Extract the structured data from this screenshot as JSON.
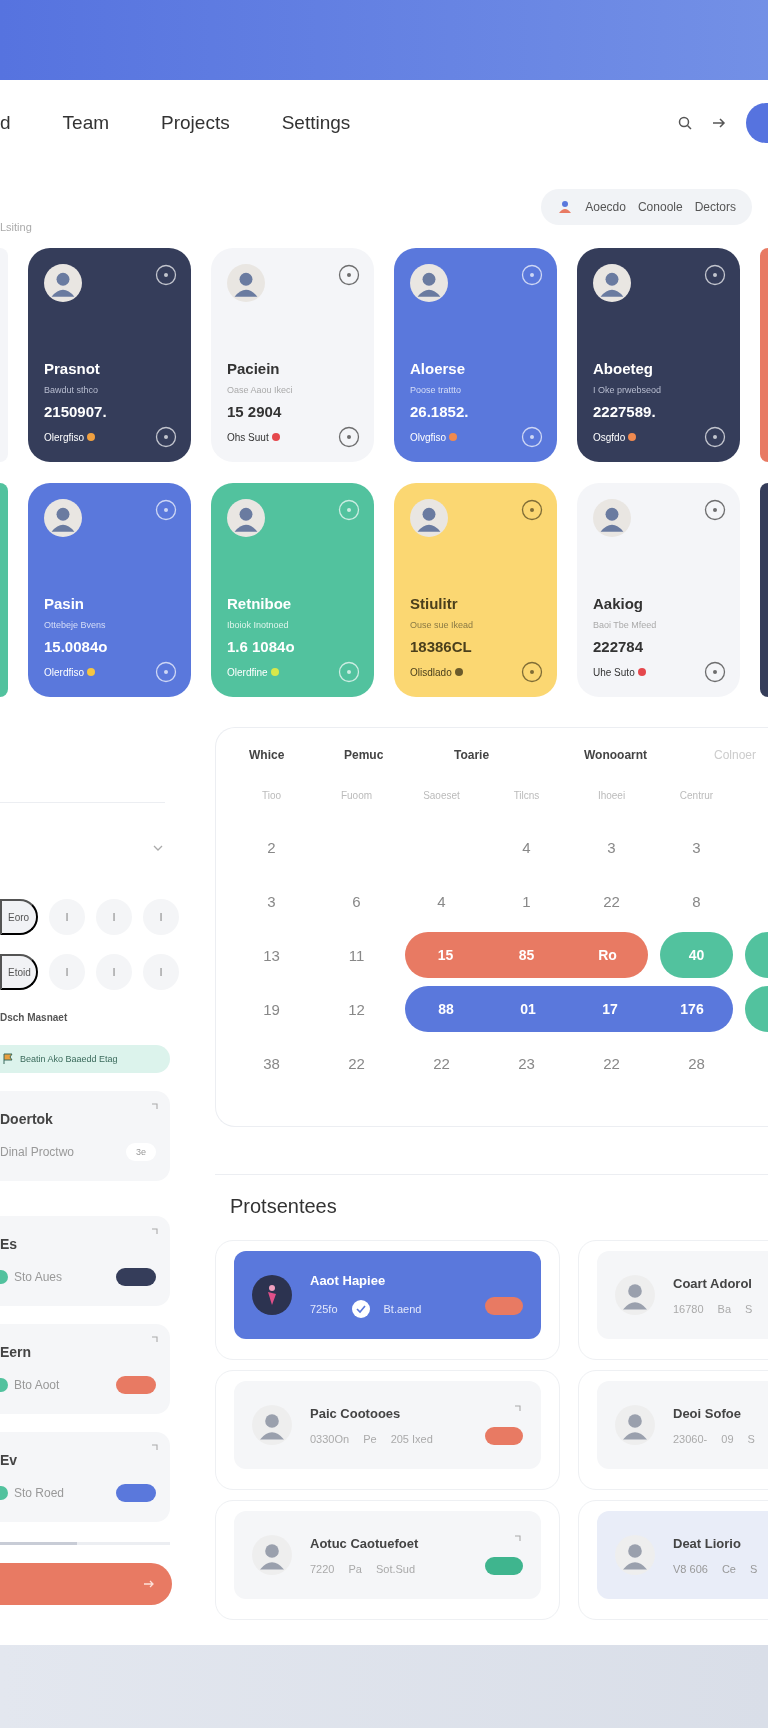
{
  "nav": {
    "tabs": [
      "d",
      "Team",
      "Projects",
      "Settings"
    ]
  },
  "subtitle": "Lsiting",
  "filter_chip": {
    "labels": [
      "Aoecdo",
      "Conoole",
      "Dectors"
    ]
  },
  "card_rows": [
    {
      "items": [
        {
          "kind": "light"
        },
        {
          "kind": "dark",
          "name": "Prasnot",
          "subtitle": "Bawdut sthco",
          "value": "2150907.",
          "footer": "Olergfiso",
          "color": "#f0a040"
        },
        {
          "kind": "light",
          "name": "Paciein",
          "subtitle": "Oase Aaou Ikeci",
          "value": "15 2904",
          "footer": "Ohs Suut",
          "color": "#e5484d"
        },
        {
          "kind": "blue",
          "name": "Aloerse",
          "subtitle": "Poose trattto",
          "value": "26.1852.",
          "footer": "Olvgfiso",
          "color": "#f08a50"
        },
        {
          "kind": "dark",
          "name": "Aboeteg",
          "subtitle": "I Oke prwebseod",
          "value": "2227589.",
          "footer": "Osgfdo",
          "color": "#f08a50"
        },
        {
          "kind": "orange"
        }
      ]
    },
    {
      "items": [
        {
          "kind": "green"
        },
        {
          "kind": "blue",
          "name": "Pasin",
          "subtitle": "Ottebeje Bvens",
          "value": "15.0084o",
          "footer": "Olerdfiso",
          "color": "#f5c542"
        },
        {
          "kind": "green",
          "name": "Retniboe",
          "subtitle": "Iboiok Inotnoed",
          "value": "1.6 1084o",
          "footer": "Olerdfine",
          "color": "#d8e84a"
        },
        {
          "kind": "yellow",
          "name": "Stiulitr",
          "subtitle": "Ouse sue Ikead",
          "value": "18386CL",
          "footer": "Olisdlado",
          "color": "#6b5a2a"
        },
        {
          "kind": "light",
          "name": "Aakiog",
          "subtitle": "Baoi Tbe Mfeed",
          "value": "222784",
          "footer": "Uhe Suto",
          "color": "#e5484d"
        },
        {
          "kind": "dark"
        }
      ]
    }
  ],
  "side_panel": {
    "pill_rows": [
      {
        "label": "Eoro",
        "marks": [
          "I",
          "I",
          "I"
        ]
      },
      {
        "label": "Etoid",
        "marks": [
          "I",
          "I",
          "I"
        ]
      }
    ],
    "section_label": "Dsch Masnaet",
    "tag": "Beatin Ako Baaedd Etag",
    "items": [
      {
        "kind": "note",
        "title": "Doertok",
        "subtitle": "Dinal Proctwo",
        "badge": "3e"
      },
      {
        "kind": "status",
        "title": "Es",
        "subtitle": "Sto Aues",
        "color": "#353d5a"
      },
      {
        "kind": "status",
        "title": "Eern",
        "subtitle": "Bto Aoot",
        "color": "#e87a63"
      },
      {
        "kind": "status",
        "title": "Ev",
        "subtitle": "Sto Roed",
        "color": "#5a78dc"
      }
    ],
    "progress": {
      "level": 0.45
    }
  },
  "calendar": {
    "headers": [
      "Whice",
      "Pemuc",
      "Toarie",
      "Wonooarnt",
      "Colnoer"
    ],
    "weekdays": [
      "Tioo",
      "Fuoom",
      "Saoeset",
      "Tilcns",
      "Ihoeei",
      "Centrur"
    ],
    "weeks": [
      {
        "cells": [
          {
            "kind": "day",
            "day": "2"
          },
          {
            "kind": "empty"
          },
          {
            "kind": "empty"
          },
          {
            "kind": "day",
            "day": "4"
          },
          {
            "kind": "day",
            "day": "3"
          },
          {
            "kind": "day",
            "day": "3"
          }
        ]
      },
      {
        "cells": [
          {
            "kind": "day",
            "day": "3"
          },
          {
            "kind": "day",
            "day": "6"
          },
          {
            "kind": "day",
            "day": "4"
          },
          {
            "kind": "day",
            "day": "1"
          },
          {
            "kind": "day",
            "day": "22"
          },
          {
            "kind": "day",
            "day": "8"
          }
        ]
      },
      {
        "cells": [
          {
            "kind": "day",
            "day": "13"
          },
          {
            "kind": "day",
            "day": "11"
          },
          {
            "kind": "event",
            "color": "#e87a63",
            "days": [
              "15",
              "85",
              "Ro"
            ]
          },
          {
            "kind": "event",
            "color": "#52c29e",
            "days": [
              "40"
            ]
          },
          {
            "kind": "event",
            "color": "#52c29e"
          }
        ]
      },
      {
        "cells": [
          {
            "kind": "day",
            "day": "19"
          },
          {
            "kind": "day",
            "day": "12"
          },
          {
            "kind": "event",
            "color": "#5a78dc",
            "days": [
              "88",
              "01",
              "17",
              "176"
            ]
          },
          {
            "kind": "event",
            "color": "#52c29e"
          }
        ]
      },
      {
        "cells": [
          {
            "kind": "day",
            "day": "38"
          },
          {
            "kind": "day",
            "day": "22"
          },
          {
            "kind": "day",
            "day": "22"
          },
          {
            "kind": "day",
            "day": "23"
          },
          {
            "kind": "day",
            "day": "22"
          },
          {
            "kind": "day",
            "day": "28"
          }
        ]
      }
    ]
  },
  "people": {
    "title": "Protsentees",
    "items": [
      {
        "kind": "primary",
        "name": "Aaot Hapiee",
        "stats": [
          "725fo",
          "Bt.aend"
        ],
        "verified": true,
        "color": "#e87a63"
      },
      {
        "kind": "plain",
        "name": "Coart Adorol",
        "stats": [
          "16780",
          "Ba",
          "S"
        ],
        "verified": false
      },
      {
        "kind": "plain",
        "name": "Paic Cootooes",
        "stats": [
          "0330On",
          "Pe",
          "205 Ixed"
        ],
        "verified": false,
        "color": "#e87a63"
      },
      {
        "kind": "plain",
        "name": "Deoi Sofoe",
        "stats": [
          "23060-",
          "09",
          "S"
        ],
        "verified": false
      },
      {
        "kind": "plain",
        "name": "Aotuc Caotuefoet",
        "stats": [
          "7220",
          "Pa",
          "Sot.Sud"
        ],
        "verified": false,
        "color": "#3fb58e"
      },
      {
        "kind": "tinted",
        "name": "Deat Liorio",
        "stats": [
          "V8 606",
          "Ce",
          "S"
        ],
        "verified": false
      }
    ]
  }
}
